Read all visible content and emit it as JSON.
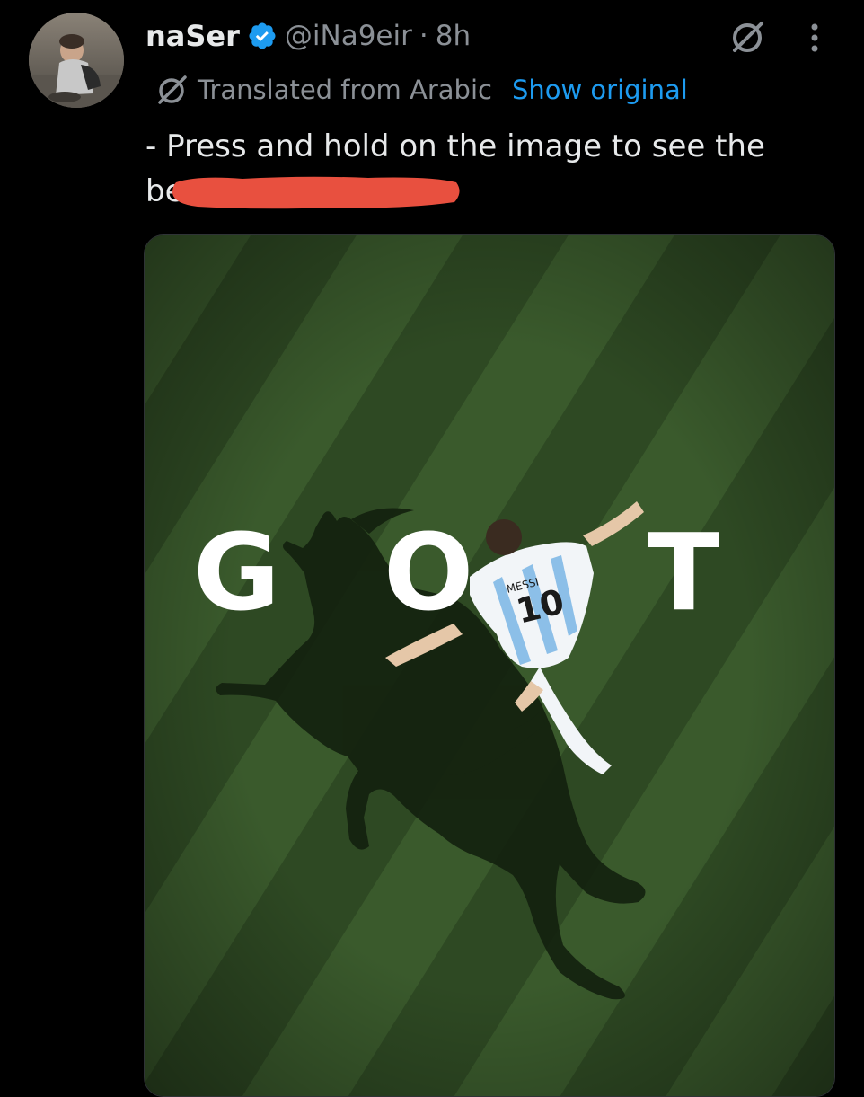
{
  "tweet": {
    "author": {
      "display_name": "naSer",
      "handle": "@iNa9eir",
      "verified": true,
      "avatar_icon": "profile-photo"
    },
    "separator": "·",
    "time": "8h",
    "grok_icon": "grok-icon",
    "more_icon": "more-vertical-icon",
    "translation": {
      "icon": "grok-icon",
      "label": "Translated from Arabic",
      "show_original": "Show original"
    },
    "text_line1": "- Press and hold on the image to see the",
    "text_line2": "be",
    "media": {
      "letters": [
        "G",
        "O",
        "T"
      ],
      "jersey_name": "MESSI",
      "jersey_number": "10"
    }
  },
  "colors": {
    "background": "#000000",
    "text": "#e7e9ea",
    "secondary": "#8b9096",
    "link": "#1d9bf0",
    "verified": "#1d9bf0",
    "redaction": "#e8503f",
    "grass": "#2f4a24"
  }
}
